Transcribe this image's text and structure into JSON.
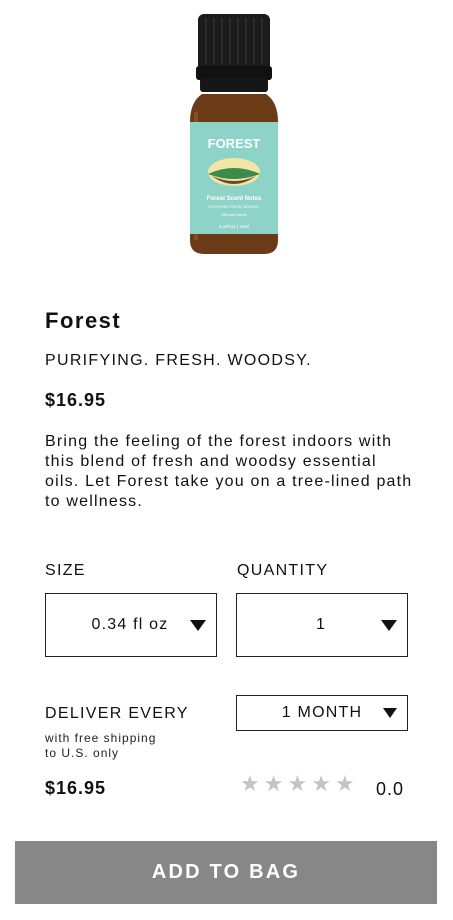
{
  "product": {
    "name": "Forest",
    "tagline": "PURIFYING. FRESH. WOODSY.",
    "price": "$16.95",
    "description": "Bring the feeling of the forest indoors with this blend of fresh and woodsy essential oils. Let Forest take you on a tree-lined path to wellness.",
    "label": {
      "name": "FOREST",
      "scent_notes": "Forest Scent Notes",
      "sub_notes": "PURIFYING. FRESH. WOODSY.",
      "use": "Diffuser Blend",
      "volume": "0.34fl.oz | 10ml"
    }
  },
  "options": {
    "size_label": "SIZE",
    "size_value": "0.34 fl oz",
    "quantity_label": "QUANTITY",
    "quantity_value": "1",
    "deliver_label": "DELIVER EVERY",
    "shipping_line1": "with free shipping",
    "shipping_line2": "to U.S. only",
    "deliver_value": "1 MONTH"
  },
  "summary": {
    "price": "$16.95",
    "rating": "0.0",
    "stars": 0,
    "stars_total": 5
  },
  "cta": {
    "label": "ADD TO BAG"
  },
  "colors": {
    "button": "#878787",
    "label_teal": "#8ed3c7",
    "bottle": "#6b3a17",
    "star_empty": "#c4c4c4"
  }
}
